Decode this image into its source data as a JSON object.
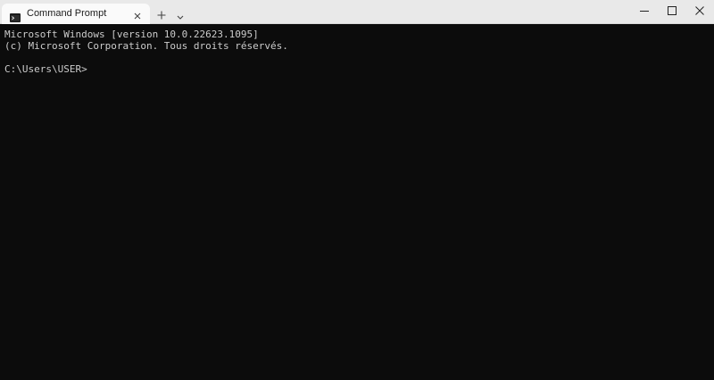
{
  "window": {
    "tab_title": "Command Prompt"
  },
  "terminal": {
    "lines": [
      "Microsoft Windows [version 10.0.22623.1095]",
      "(c) Microsoft Corporation. Tous droits réservés.",
      "C:\\Users\\USER>"
    ]
  },
  "icons": {
    "tab": "terminal-icon",
    "tab_close": "close-icon",
    "new_tab": "plus-icon",
    "dropdown": "chevron-down-icon",
    "minimize": "minimize-icon",
    "maximize": "maximize-icon",
    "close": "close-icon"
  },
  "colors": {
    "terminal_background": "#0c0c0c",
    "terminal_text": "#cccccc",
    "titlebar": "#e9e9e9",
    "active_tab": "#fafafa"
  }
}
